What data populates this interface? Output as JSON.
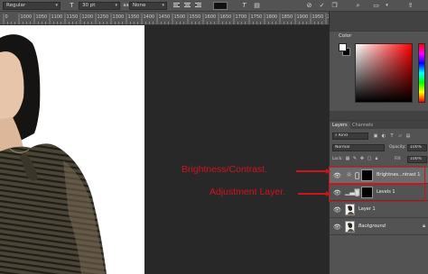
{
  "options_bar": {
    "font_style": "Regular",
    "font_size": "30 pt",
    "antialias_label": "aa",
    "antialias": "None"
  },
  "ruler": {
    "ticks": [
      "0",
      "1000",
      "1050",
      "1100",
      "1150",
      "1200",
      "1250",
      "1300",
      "1350",
      "1400",
      "1450",
      "1500",
      "1550",
      "1600",
      "1650",
      "1700",
      "1750",
      "1800",
      "1850",
      "1900",
      "1950",
      "2000"
    ]
  },
  "color_panel": {
    "tab": "Color",
    "foreground": "#ffffff",
    "background": "#000000"
  },
  "layers_panel": {
    "tabs": [
      "Layers",
      "Channels"
    ],
    "kind_filter": "Kind",
    "blend_mode": "Normal",
    "opacity_label": "Opacity:",
    "opacity": "100%",
    "lock_label": "Lock:",
    "fill_label": "Fill:",
    "fill": "100%",
    "layers": [
      {
        "name": "Brightnes...ntrast 1",
        "icon": "brightness-contrast-icon",
        "selected": true
      },
      {
        "name": "Levels 1",
        "icon": "levels-icon",
        "selected": false
      },
      {
        "name": "Layer 1",
        "icon": "photo-thumb",
        "selected": false
      },
      {
        "name": "Background",
        "icon": "photo-thumb",
        "selected": false,
        "locked": true
      }
    ]
  },
  "annotations": {
    "first": "Brightness/Contrast.",
    "second": "Adjustment Layer.",
    "color": "#d0131a"
  }
}
